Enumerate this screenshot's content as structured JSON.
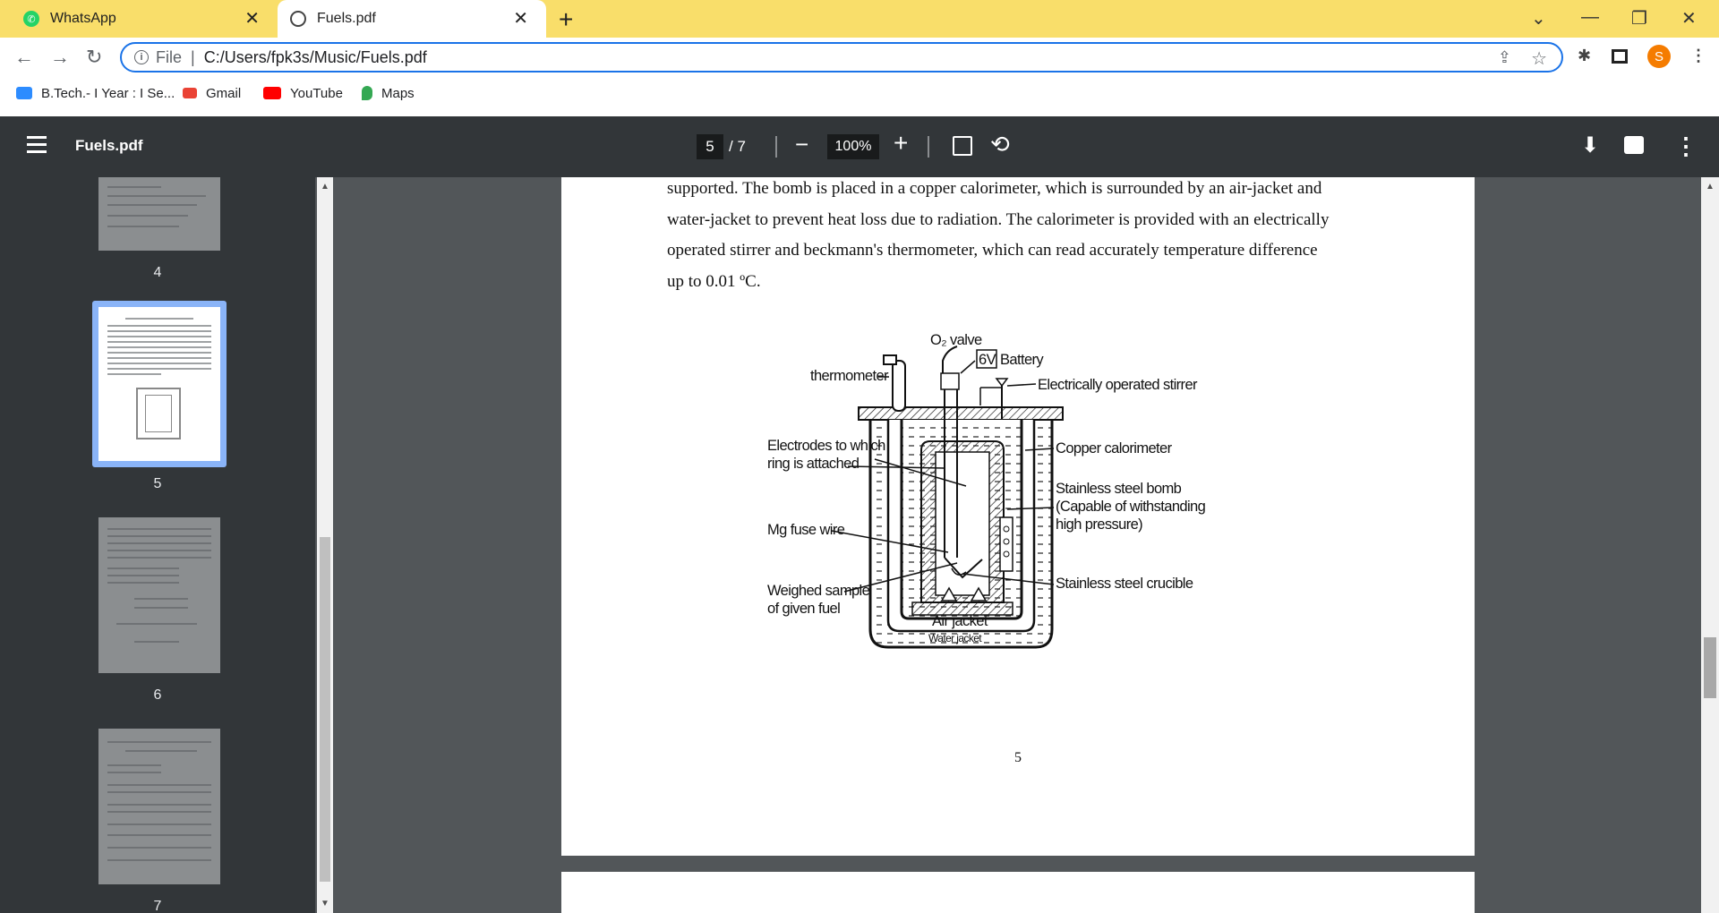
{
  "browser": {
    "tabs": [
      {
        "label": "WhatsApp",
        "icon": "whatsapp-icon",
        "active": false
      },
      {
        "label": "Fuels.pdf",
        "icon": "globe-icon",
        "active": true
      }
    ],
    "new_tab": "+",
    "window_controls": [
      "⌄",
      "—",
      "❐",
      "✕"
    ]
  },
  "omnibox": {
    "scheme": "File",
    "separator": "|",
    "url": "C:/Users/fpk3s/Music/Fuels.pdf"
  },
  "profile": {
    "initial": "S",
    "color": "#f57c00"
  },
  "bookmarks": [
    {
      "label": "B.Tech.- I Year : I Se...",
      "icon": "zoom-icon",
      "color": "#2d8cff"
    },
    {
      "label": "Gmail",
      "icon": "gmail-icon",
      "color": "#ea4335"
    },
    {
      "label": "YouTube",
      "icon": "youtube-icon",
      "color": "#ff0000"
    },
    {
      "label": "Maps",
      "icon": "maps-icon",
      "color": "#34a853"
    }
  ],
  "pdf_toolbar": {
    "title": "Fuels.pdf",
    "current_page": "5",
    "separator": "/",
    "total_pages": "7",
    "zoom": "100%"
  },
  "thumbnails": [
    {
      "number": "4",
      "selected": false
    },
    {
      "number": "5",
      "selected": true
    },
    {
      "number": "6",
      "selected": false
    },
    {
      "number": "7",
      "selected": false
    }
  ],
  "document": {
    "lines": [
      "supported. The bomb is placed in a copper calorimeter, which is surrounded by an air-jacket and",
      "water-jacket to prevent heat loss due to radiation. The calorimeter is provided with an electrically",
      "operated stirrer and beckmann's thermometer, which can read accurately temperature difference",
      "up to 0.01 ºC."
    ],
    "page_number": "5",
    "diagram_labels": {
      "o2_valve": "O₂ valve",
      "six_v": "6V",
      "battery": "Battery",
      "thermometer": "thermometer",
      "stirrer": "Electrically operated stirrer",
      "electrodes_1": "Electrodes to which",
      "electrodes_2": "ring is attached",
      "copper": "Copper calorimeter",
      "bomb_1": "Stainless steel bomb",
      "bomb_2": "(Capable of withstanding",
      "bomb_3": "high pressure)",
      "mg_wire": "Mg fuse wire",
      "crucible": "Stainless steel crucible",
      "sample_1": "Weighed sample",
      "sample_2": "of given fuel",
      "air_jacket": "Air jacket",
      "water_jacket": "Water jacket"
    }
  }
}
